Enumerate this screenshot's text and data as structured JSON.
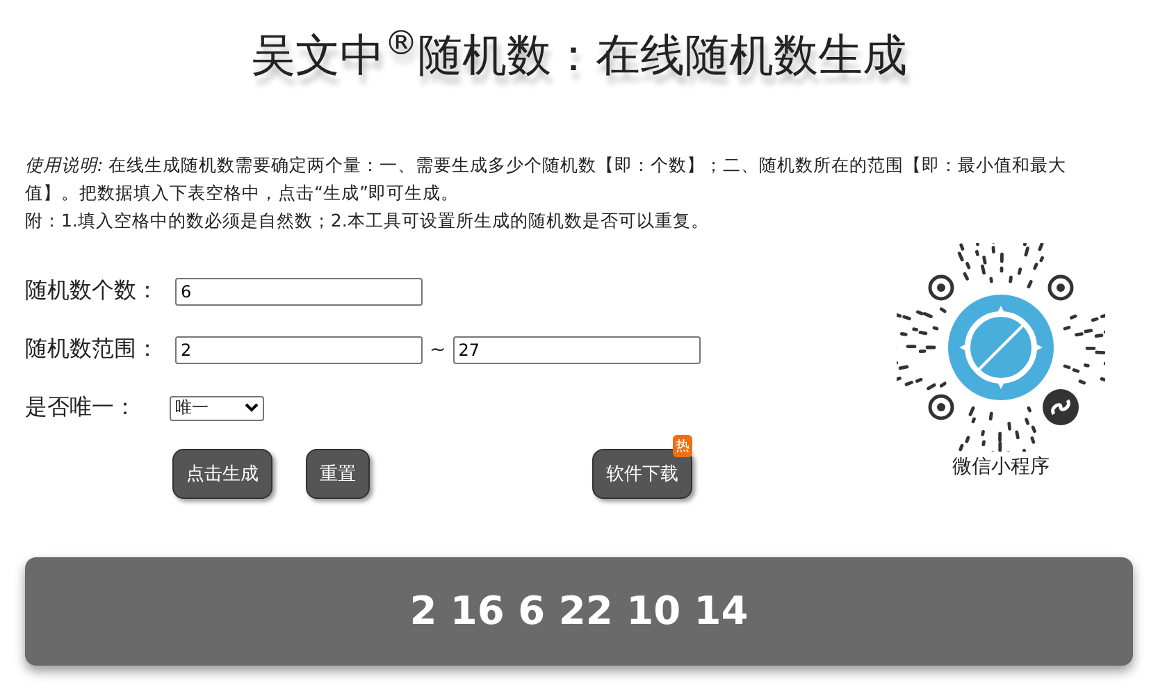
{
  "title": "吴文中$^{®}$随机数：在线随机数生成",
  "instructions": [
    "*使用说明:* 在线生成随机数需要确定两个量：一、需要生成多少个随机数【即：个数】；二、随机数所在的范围【即：最小值和最大值】。把数据填入下表空格中，点击“生成”即可生成。",
    "附：1.填入空格中的数必须是自然数；2.本工具可设置所生成的随机数是否可以重复。"
  ],
  "count": {
    "label": "随机数个数：",
    "value": "6"
  },
  "range": {
    "label": "随机数范围：",
    "min": "2",
    "separator": "~",
    "max": "27"
  },
  "unique": {
    "label": "是否唯一：",
    "value": "唯一"
  },
  "buttons": [
    {
      "label": "点击生成"
    },
    {
      "label": "重置"
    },
    {
      "label": "软件下载",
      "badge": "热"
    }
  ],
  "mini_program": {
    "caption": "微信小程序"
  },
  "result": "2 16 6 22 10 14"
}
